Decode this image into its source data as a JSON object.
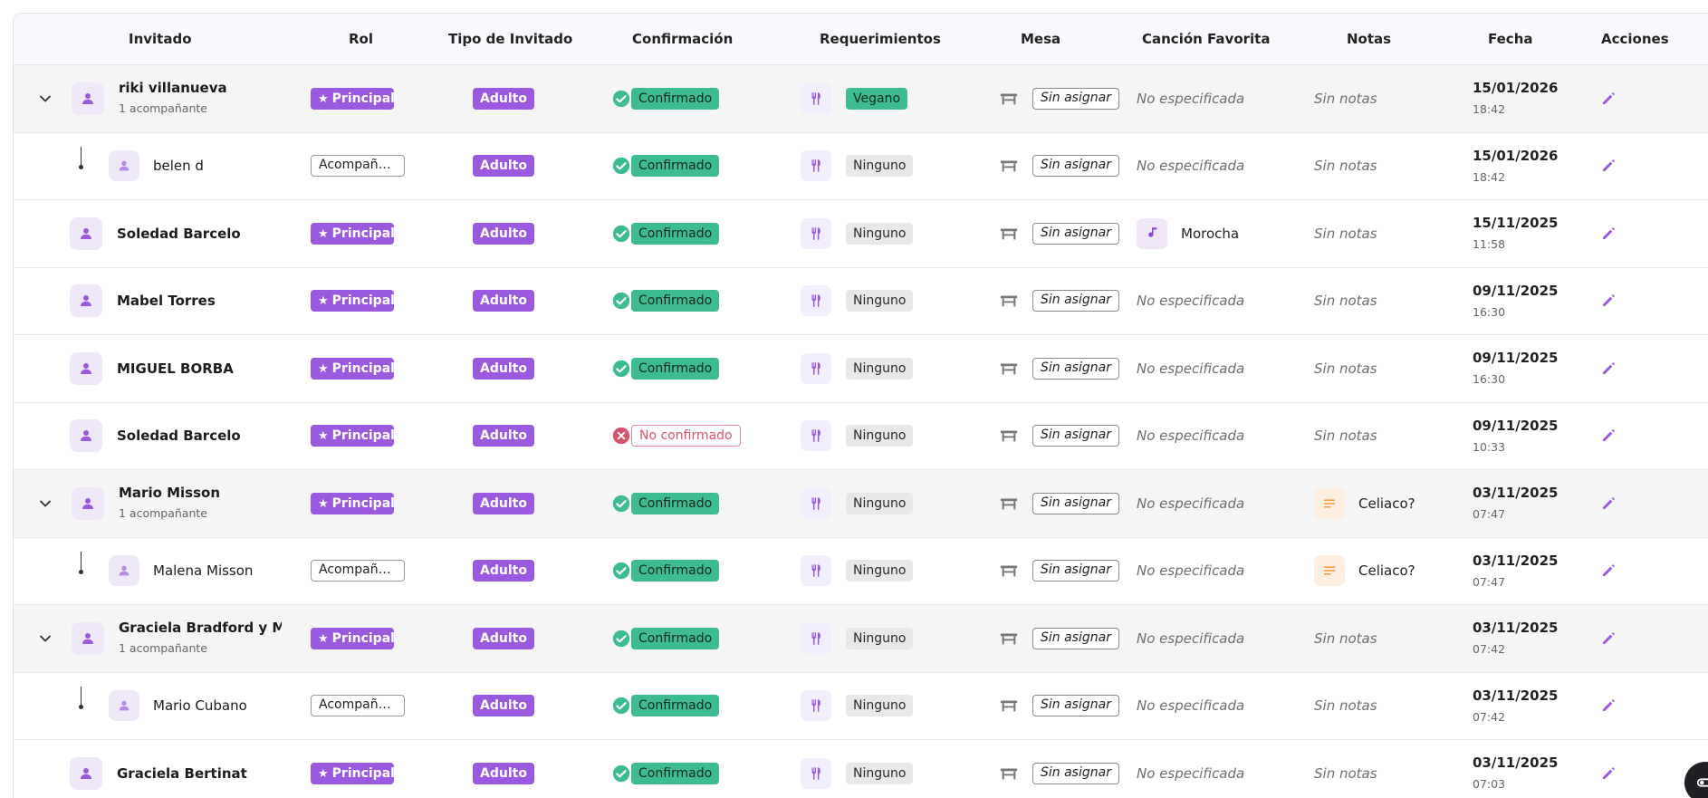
{
  "headers": {
    "invitado": "Invitado",
    "rol": "Rol",
    "tipo": "Tipo de Invitado",
    "confirmacion": "Confirmación",
    "requerimientos": "Requerimientos",
    "mesa": "Mesa",
    "cancion": "Canción Favorita",
    "notas": "Notas",
    "fecha": "Fecha",
    "acciones": "Acciones"
  },
  "colors": {
    "accent": "#9b59df",
    "confirmed": "#3dbb91",
    "not_confirmed": "#d9536a"
  },
  "rows": [
    {
      "kind": "principal",
      "expandable": true,
      "name": "riki villanueva",
      "sub": "1 acompañante",
      "rol": "Principal",
      "tipo": "Adulto",
      "confirmacion": "Confirmado",
      "confirmed": true,
      "req": "Vegano",
      "mesa": "Sin asignar",
      "cancion": "No especificada",
      "cancion_set": false,
      "notas": "Sin notas",
      "notas_set": false,
      "fecha": "15/01/2026",
      "hora": "18:42"
    },
    {
      "kind": "companion",
      "name": "belen d",
      "rol": "Acompaña...",
      "tipo": "Adulto",
      "confirmacion": "Confirmado",
      "confirmed": true,
      "req": "Ninguno",
      "mesa": "Sin asignar",
      "cancion": "No especificada",
      "cancion_set": false,
      "notas": "Sin notas",
      "notas_set": false,
      "fecha": "15/01/2026",
      "hora": "18:42"
    },
    {
      "kind": "principal",
      "expandable": false,
      "name": "Soledad Barcelo",
      "rol": "Principal",
      "tipo": "Adulto",
      "confirmacion": "Confirmado",
      "confirmed": true,
      "req": "Ninguno",
      "mesa": "Sin asignar",
      "cancion": "Morocha",
      "cancion_set": true,
      "notas": "Sin notas",
      "notas_set": false,
      "fecha": "15/11/2025",
      "hora": "11:58"
    },
    {
      "kind": "principal",
      "expandable": false,
      "name": "Mabel Torres",
      "rol": "Principal",
      "tipo": "Adulto",
      "confirmacion": "Confirmado",
      "confirmed": true,
      "req": "Ninguno",
      "mesa": "Sin asignar",
      "cancion": "No especificada",
      "cancion_set": false,
      "notas": "Sin notas",
      "notas_set": false,
      "fecha": "09/11/2025",
      "hora": "16:30"
    },
    {
      "kind": "principal",
      "expandable": false,
      "name": "MIGUEL BORBA",
      "rol": "Principal",
      "tipo": "Adulto",
      "confirmacion": "Confirmado",
      "confirmed": true,
      "req": "Ninguno",
      "mesa": "Sin asignar",
      "cancion": "No especificada",
      "cancion_set": false,
      "notas": "Sin notas",
      "notas_set": false,
      "fecha": "09/11/2025",
      "hora": "16:30"
    },
    {
      "kind": "principal",
      "expandable": false,
      "name": "Soledad Barcelo",
      "rol": "Principal",
      "tipo": "Adulto",
      "confirmacion": "No confirmado",
      "confirmed": false,
      "req": "Ninguno",
      "mesa": "Sin asignar",
      "cancion": "No especificada",
      "cancion_set": false,
      "notas": "Sin notas",
      "notas_set": false,
      "fecha": "09/11/2025",
      "hora": "10:33"
    },
    {
      "kind": "principal",
      "expandable": true,
      "name": "Mario Misson",
      "sub": "1 acompañante",
      "rol": "Principal",
      "tipo": "Adulto",
      "confirmacion": "Confirmado",
      "confirmed": true,
      "req": "Ninguno",
      "mesa": "Sin asignar",
      "cancion": "No especificada",
      "cancion_set": false,
      "notas": "Celiaco?",
      "notas_set": true,
      "fecha": "03/11/2025",
      "hora": "07:47"
    },
    {
      "kind": "companion",
      "name": "Malena Misson",
      "rol": "Acompaña...",
      "tipo": "Adulto",
      "confirmacion": "Confirmado",
      "confirmed": true,
      "req": "Ninguno",
      "mesa": "Sin asignar",
      "cancion": "No especificada",
      "cancion_set": false,
      "notas": "Celiaco?",
      "notas_set": true,
      "fecha": "03/11/2025",
      "hora": "07:47"
    },
    {
      "kind": "principal",
      "expandable": true,
      "name": "Graciela Bradford y Mar...",
      "sub": "1 acompañante",
      "rol": "Principal",
      "tipo": "Adulto",
      "confirmacion": "Confirmado",
      "confirmed": true,
      "req": "Ninguno",
      "mesa": "Sin asignar",
      "cancion": "No especificada",
      "cancion_set": false,
      "notas": "Sin notas",
      "notas_set": false,
      "fecha": "03/11/2025",
      "hora": "07:42"
    },
    {
      "kind": "companion",
      "name": "Mario Cubano",
      "rol": "Acompaña...",
      "tipo": "Adulto",
      "confirmacion": "Confirmado",
      "confirmed": true,
      "req": "Ninguno",
      "mesa": "Sin asignar",
      "cancion": "No especificada",
      "cancion_set": false,
      "notas": "Sin notas",
      "notas_set": false,
      "fecha": "03/11/2025",
      "hora": "07:42"
    },
    {
      "kind": "principal",
      "expandable": false,
      "name": "Graciela Bertinat",
      "rol": "Principal",
      "tipo": "Adulto",
      "confirmacion": "Confirmado",
      "confirmed": true,
      "req": "Ninguno",
      "mesa": "Sin asignar",
      "cancion": "No especificada",
      "cancion_set": false,
      "notas": "Sin notas",
      "notas_set": false,
      "fecha": "03/11/2025",
      "hora": "07:03"
    }
  ]
}
